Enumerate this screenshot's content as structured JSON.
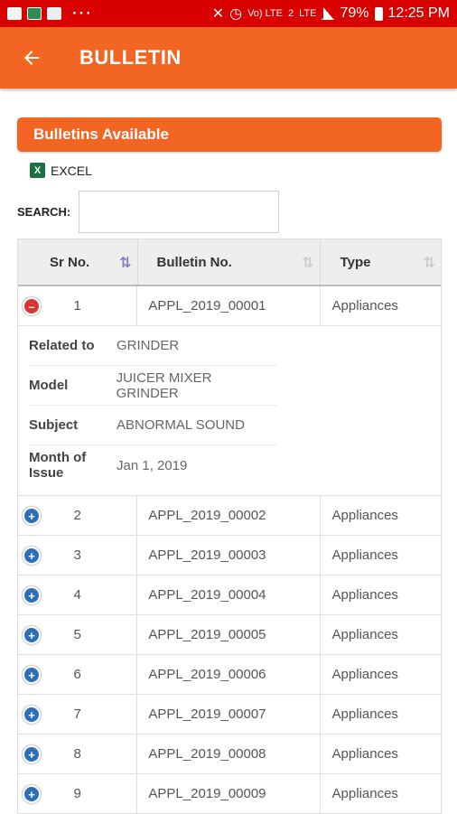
{
  "status_bar": {
    "time": "12:25 PM",
    "battery": "79%",
    "volte": "Vo) LTE",
    "sim": "2",
    "lte": "LTE"
  },
  "app_bar": {
    "title": "BULLETIN"
  },
  "panel": {
    "title": "Bulletins Available"
  },
  "excel": {
    "label": "EXCEL"
  },
  "search": {
    "label": "SEARCH:",
    "value": ""
  },
  "table": {
    "headers": [
      "Sr No.",
      "Bulletin No.",
      "Type"
    ],
    "expanded_row": {
      "sr": "1",
      "bulletin": "APPL_2019_00001",
      "type": "Appliances",
      "details": [
        {
          "key": "Related to",
          "value": "GRINDER"
        },
        {
          "key": "Model",
          "value": "JUICER MIXER GRINDER"
        },
        {
          "key": "Subject",
          "value": "ABNORMAL SOUND"
        },
        {
          "key": "Month of Issue",
          "value": "Jan 1, 2019"
        }
      ]
    },
    "rows": [
      {
        "sr": "2",
        "bulletin": "APPL_2019_00002",
        "type": "Appliances"
      },
      {
        "sr": "3",
        "bulletin": "APPL_2019_00003",
        "type": "Appliances"
      },
      {
        "sr": "4",
        "bulletin": "APPL_2019_00004",
        "type": "Appliances"
      },
      {
        "sr": "5",
        "bulletin": "APPL_2019_00005",
        "type": "Appliances"
      },
      {
        "sr": "6",
        "bulletin": "APPL_2019_00006",
        "type": "Appliances"
      },
      {
        "sr": "7",
        "bulletin": "APPL_2019_00007",
        "type": "Appliances"
      },
      {
        "sr": "8",
        "bulletin": "APPL_2019_00008",
        "type": "Appliances"
      },
      {
        "sr": "9",
        "bulletin": "APPL_2019_00009",
        "type": "Appliances"
      }
    ]
  },
  "colors": {
    "accent": "#f26522",
    "status_bar": "#d90000",
    "expand": "#2c6fb7",
    "collapse": "#d33333"
  },
  "icons": {
    "back": "arrow-left-icon",
    "excel": "excel-icon",
    "sort": "sort-icon"
  }
}
